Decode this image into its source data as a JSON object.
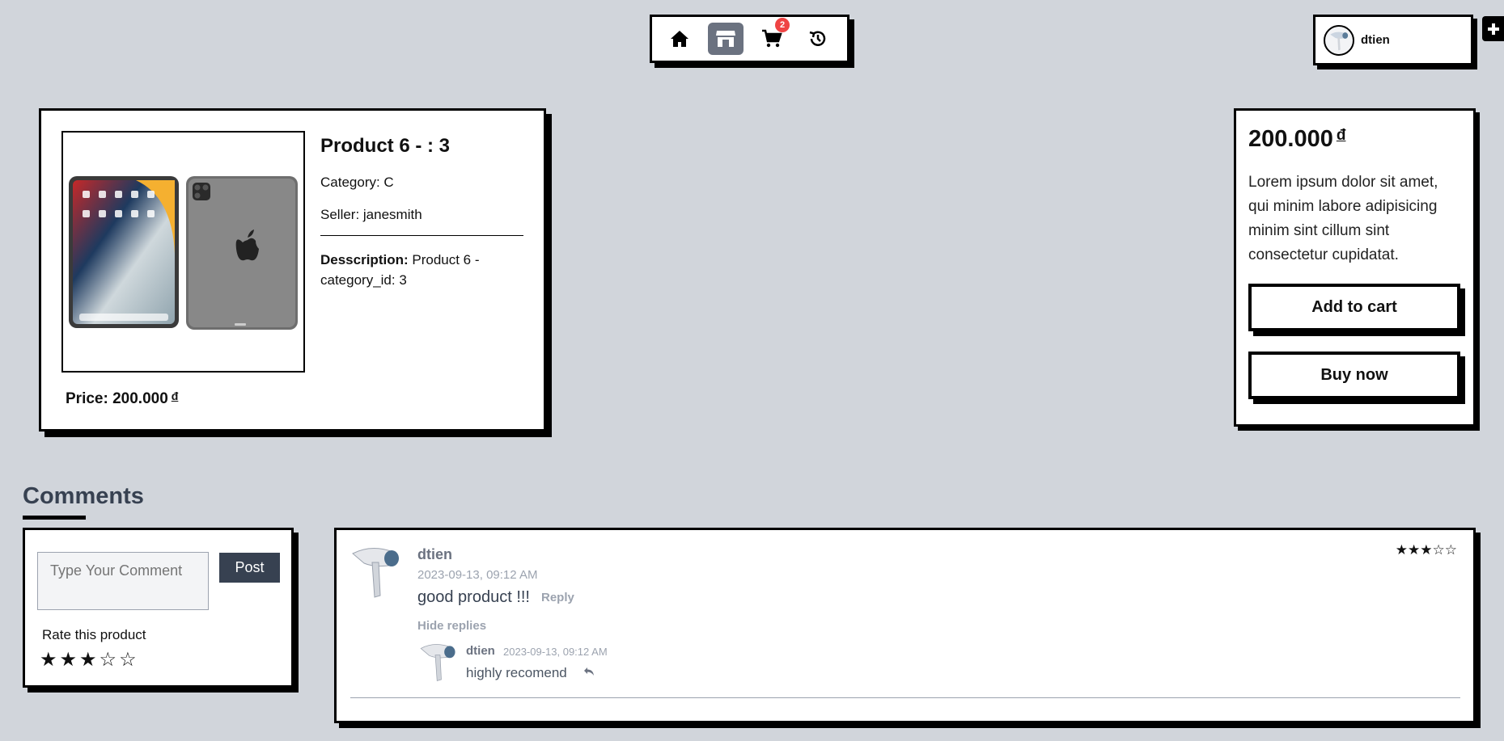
{
  "nav": {
    "cart_badge": "2",
    "items": [
      {
        "icon": "home-icon"
      },
      {
        "icon": "store-icon",
        "active": true
      },
      {
        "icon": "cart-icon"
      },
      {
        "icon": "history-icon"
      }
    ]
  },
  "user": {
    "name": "dtien"
  },
  "product": {
    "title": "Product 6 - : 3",
    "category": "Category: C",
    "seller": "Seller: janesmith",
    "description_label": "Desscription:",
    "description": "Product 6 - category_id: 3",
    "price_label": "Price: 200.000",
    "currency": "đ"
  },
  "buy_box": {
    "price": "200.000",
    "currency": "đ",
    "description": "Lorem ipsum dolor sit amet, qui minim labore adipisicing minim sint cillum sint consectetur cupidatat.",
    "add_to_cart": "Add to cart",
    "buy_now": "Buy now"
  },
  "comments": {
    "title": "Comments",
    "form": {
      "placeholder": "Type Your Comment",
      "post": "Post",
      "rate_label": "Rate this product",
      "rating": 3,
      "max_rating": 5
    },
    "items": [
      {
        "author": "dtien",
        "date": "2023-09-13, 09:12 AM",
        "text": "good product !!!",
        "reply_label": "Reply",
        "hide_replies_label": "Hide replies",
        "rating": 3,
        "replies": [
          {
            "author": "dtien",
            "date": "2023-09-13, 09:12 AM",
            "text": "highly recomend"
          }
        ]
      }
    ]
  }
}
